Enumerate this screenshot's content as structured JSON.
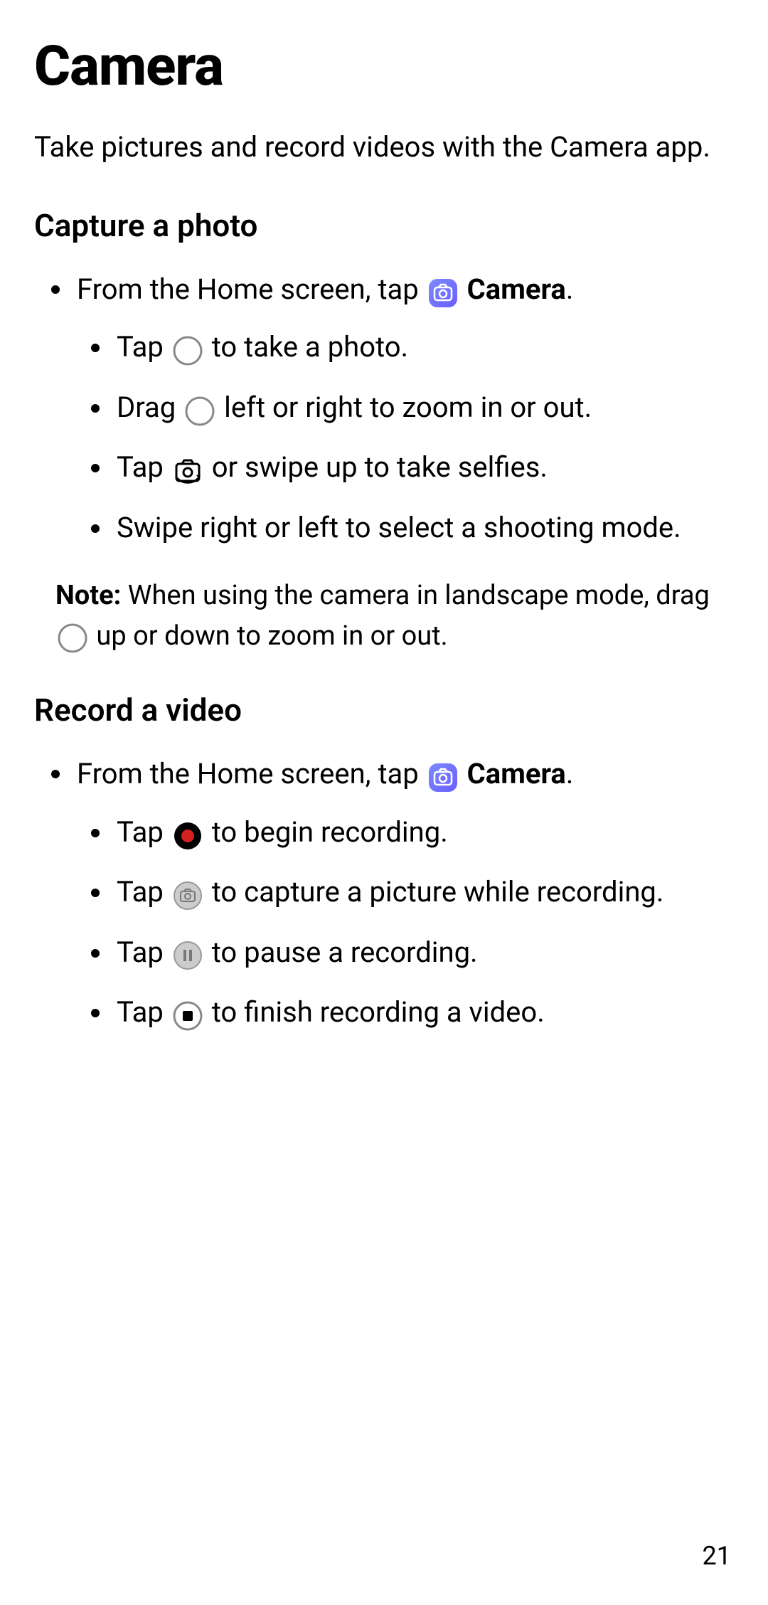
{
  "title": "Camera",
  "intro": "Take pictures and record videos with the Camera app.",
  "section1": {
    "heading": "Capture a photo",
    "item1_pre": "From the Home screen, tap ",
    "item1_post_bold": "Camera",
    "item1_period": ".",
    "sub1_pre": "Tap ",
    "sub1_post": " to take a photo.",
    "sub2_pre": "Drag ",
    "sub2_post": " left or right to zoom in or out.",
    "sub3_pre": "Tap ",
    "sub3_post": " or swipe up to take selfies.",
    "sub4": "Swipe right or left to select a shooting mode."
  },
  "note": {
    "label": "Note:",
    "pre": " When using the camera in landscape mode, drag ",
    "post": " up or down to zoom in or out."
  },
  "section2": {
    "heading": "Record a video",
    "item1_pre": "From the Home screen, tap ",
    "item1_post_bold": "Camera",
    "item1_period": ".",
    "sub1_pre": "Tap ",
    "sub1_post": " to begin recording.",
    "sub2_pre": "Tap ",
    "sub2_post": " to capture a picture while recording.",
    "sub3_pre": "Tap ",
    "sub3_post": " to pause a recording.",
    "sub4_pre": "Tap ",
    "sub4_post": " to finish recording a video."
  },
  "page_number": "21"
}
